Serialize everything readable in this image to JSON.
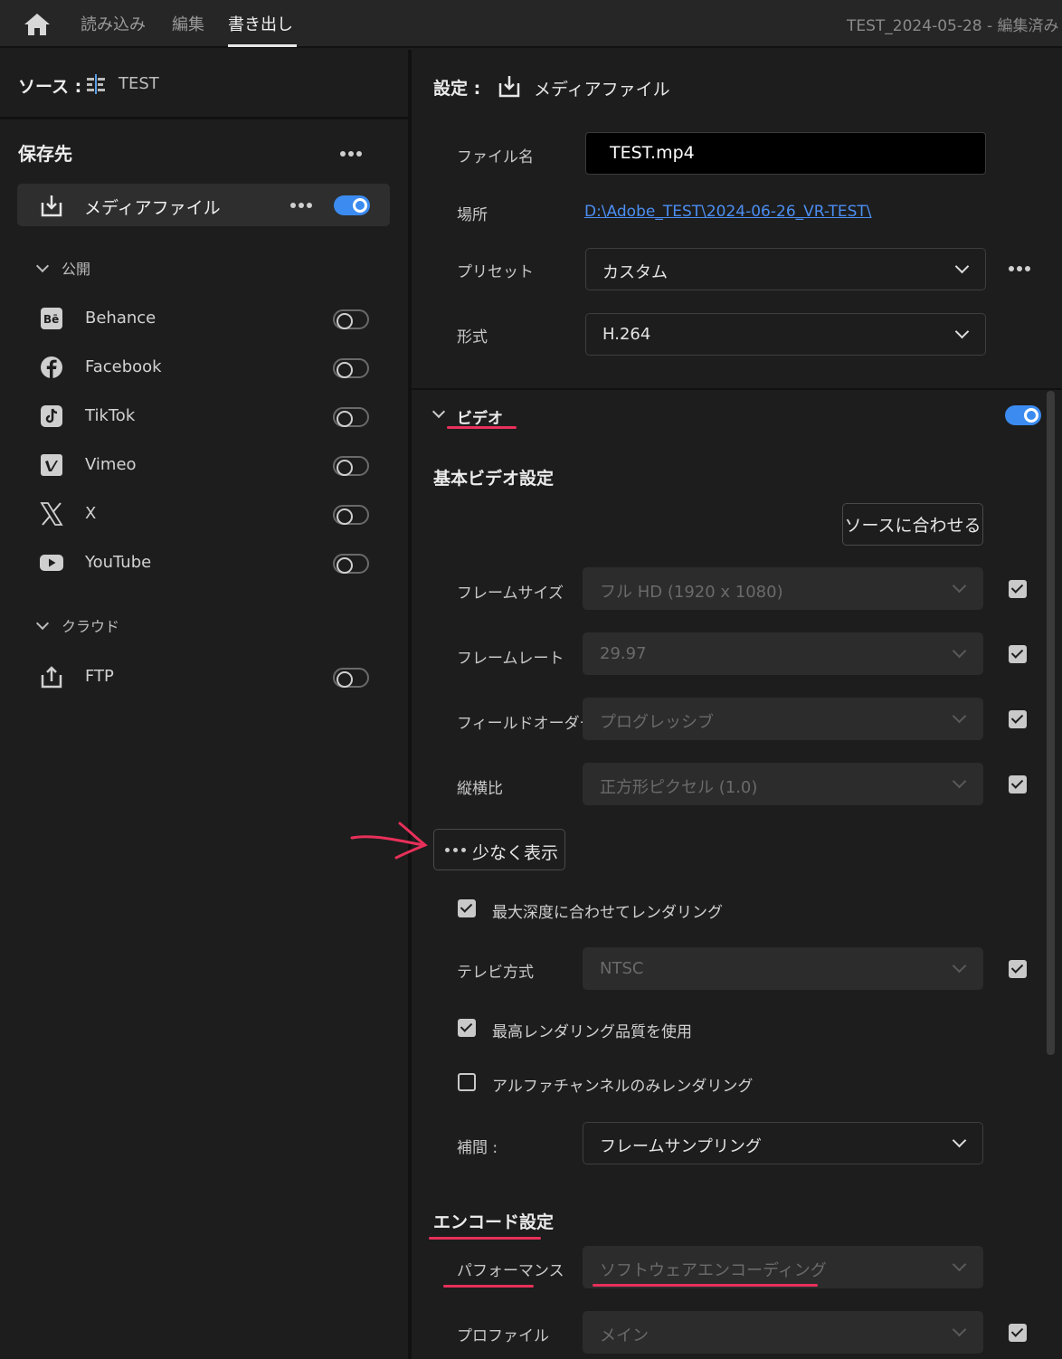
{
  "topbar": {
    "tabs": [
      "読み込み",
      "編集",
      "書き出し"
    ],
    "active_tab": "書き出し",
    "doc_title": "TEST_2024-05-28 - 編集済み"
  },
  "source": {
    "label": "ソース :",
    "name": "TEST"
  },
  "destinations": {
    "title": "保存先",
    "media_file": "メディアファイル",
    "media_enabled": true,
    "publish_group": "公開",
    "publish": [
      {
        "name": "Behance",
        "icon": "behance-icon",
        "enabled": false
      },
      {
        "name": "Facebook",
        "icon": "facebook-icon",
        "enabled": false
      },
      {
        "name": "TikTok",
        "icon": "tiktok-icon",
        "enabled": false
      },
      {
        "name": "Vimeo",
        "icon": "vimeo-icon",
        "enabled": false
      },
      {
        "name": "X",
        "icon": "x-icon",
        "enabled": false
      },
      {
        "name": "YouTube",
        "icon": "youtube-icon",
        "enabled": false
      }
    ],
    "cloud_group": "クラウド",
    "cloud": [
      {
        "name": "FTP",
        "icon": "upload-icon",
        "enabled": false
      }
    ]
  },
  "settings": {
    "label": "設定 :",
    "target": "メディアファイル",
    "filename_label": "ファイル名",
    "filename": "TEST.mp4",
    "location_label": "場所",
    "location": "D:\\Adobe_TEST\\2024-06-26_VR-TEST\\",
    "preset_label": "プリセット",
    "preset": "カスタム",
    "format_label": "形式",
    "format": "H.264"
  },
  "video": {
    "section": "ビデオ",
    "enabled": true,
    "basic_title": "基本ビデオ設定",
    "match_source": "ソースに合わせる",
    "frame_size_label": "フレームサイズ",
    "frame_size": "フル HD (1920 x 1080)",
    "frame_rate_label": "フレームレート",
    "frame_rate": "29.97",
    "field_order_label": "フィールドオーダー",
    "field_order": "プログレッシブ",
    "aspect_label": "縦横比",
    "aspect": "正方形ピクセル (1.0)",
    "show_less": "少なく表示",
    "max_depth": "最大深度に合わせてレンダリング",
    "tv_label": "テレビ方式",
    "tv": "NTSC",
    "max_quality": "最高レンダリング品質を使用",
    "alpha_only": "アルファチャンネルのみレンダリング",
    "interp_label": "補間 :",
    "interp": "フレームサンプリング"
  },
  "encode": {
    "title": "エンコード設定",
    "performance_label": "パフォーマンス",
    "performance": "ソフトウェアエンコーディング",
    "profile_label": "プロファイル",
    "profile": "メイン"
  },
  "colors": {
    "accent": "#3b8bf0",
    "annotation": "#e8305a",
    "link": "#4b8ef2"
  }
}
